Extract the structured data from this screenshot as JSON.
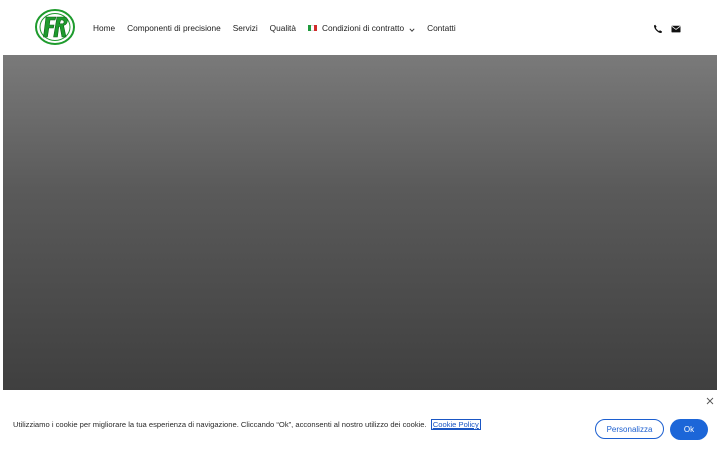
{
  "header": {
    "logo_text": "FR",
    "nav": [
      {
        "label": "Home"
      },
      {
        "label": "Componenti di precisione"
      },
      {
        "label": "Servizi"
      },
      {
        "label": "Qualità"
      },
      {
        "label": "Condizioni di contratto",
        "flag": "italy-flag-icon",
        "dropdown": true
      },
      {
        "label": "Contatti"
      }
    ],
    "icons": [
      "phone-icon",
      "envelope-icon"
    ]
  },
  "colors": {
    "logo_green": "#1e9b2d",
    "accent_blue": "#1c66d8",
    "hero_top": "#7a7a7a",
    "hero_bottom": "#3f3f3f"
  },
  "cookie": {
    "text": "Utilizziamo i cookie per migliorare la tua esperienza di navigazione. Cliccando “Ok”, acconsenti al nostro utilizzo dei cookie.",
    "link_label": "Cookie Policy",
    "customize_label": "Personalizza",
    "ok_label": "Ok"
  }
}
